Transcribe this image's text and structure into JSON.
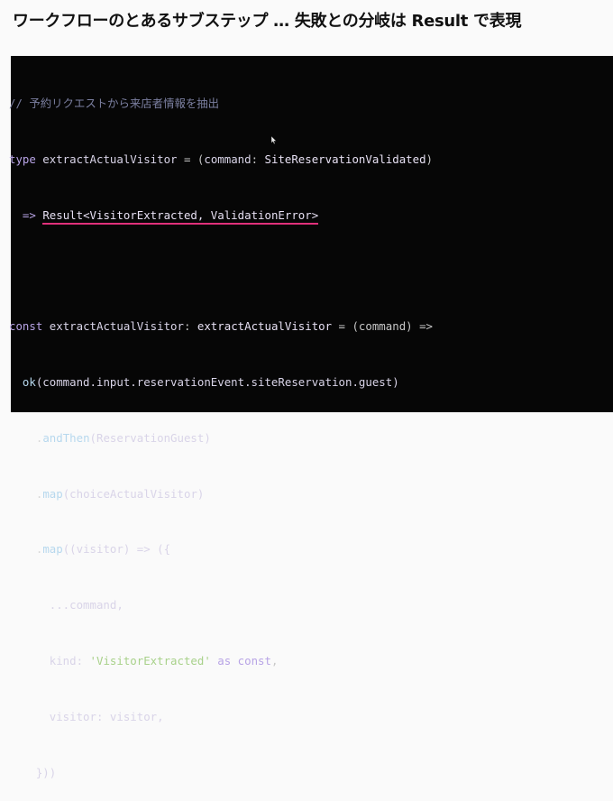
{
  "slide": {
    "title": "ワークフローのとあるサブステップ … 失敗との分岐は Result で表現"
  },
  "code": {
    "comment": "// 予約リクエストから来店者情報を抽出",
    "l2_kw": "type",
    "l2_name": " extractActualVisitor ",
    "l2_eq": "= (",
    "l2_param": "command",
    "l2_colon": ": ",
    "l2_type": "SiteReservationValidated",
    "l2_close": ")",
    "l3_indent": "  ",
    "l3_arrow": "=> ",
    "l3_result": "Result<VisitorExtracted, ValidationError>",
    "l4_blank": " ",
    "l5_kw": "const",
    "l5_name": " extractActualVisitor",
    "l5_colon": ": ",
    "l5_type": "extractActualVisitor",
    "l5_rest": " = (command) =>",
    "l6_indent": "  ",
    "l6_fn": "ok",
    "l6_rest": "(command.input.reservationEvent.siteReservation.guest)",
    "l7_indent": "    .",
    "l7_method": "andThen",
    "l7_rest": "(ReservationGuest)",
    "l8_indent": "    .",
    "l8_method": "map",
    "l8_rest": "(choiceActualVisitor)",
    "l9_indent": "    .",
    "l9_method": "map",
    "l9_rest": "((visitor) => ({",
    "l10": "      ...command,",
    "l11_key": "      kind: ",
    "l11_str": "'VisitorExtracted'",
    "l11_as": " as const",
    "l11_end": ",",
    "l12": "      visitor: visitor,",
    "l13": "    }))"
  },
  "colors": {
    "highlight_underline": "#e0307a",
    "panel_background": "#060606"
  },
  "icons": [
    "cursor-icon"
  ]
}
